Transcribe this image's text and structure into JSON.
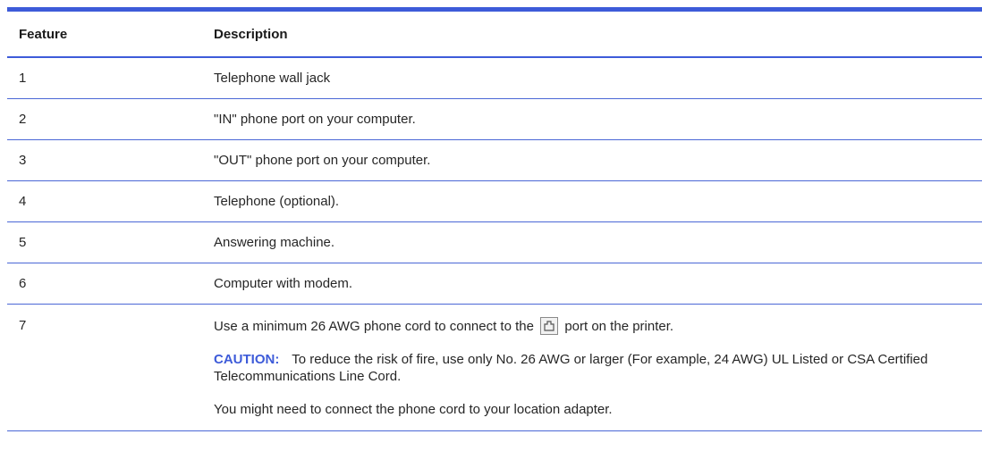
{
  "table": {
    "headers": {
      "feature": "Feature",
      "description": "Description"
    },
    "rows": [
      {
        "feature": "1",
        "description": "Telephone wall jack"
      },
      {
        "feature": "2",
        "description": "\"IN\" phone port on your computer."
      },
      {
        "feature": "3",
        "description": "\"OUT\" phone port on your computer."
      },
      {
        "feature": "4",
        "description": "Telephone (optional)."
      },
      {
        "feature": "5",
        "description": "Answering machine."
      },
      {
        "feature": "6",
        "description": "Computer with modem."
      }
    ],
    "last_row": {
      "feature": "7",
      "line1_before": "Use a minimum 26 AWG phone cord to connect to the",
      "line1_icon": "phone-port-icon",
      "line1_after": "port on the printer.",
      "caution_label": "CAUTION:",
      "caution_text": "To reduce the risk of fire, use only No. 26 AWG or larger (For example, 24 AWG) UL Listed or CSA Certified Telecommunications Line Cord.",
      "note": "You might need to connect the phone cord to your location adapter."
    }
  },
  "colors": {
    "accent": "#3d5bd9",
    "text": "#262626"
  }
}
